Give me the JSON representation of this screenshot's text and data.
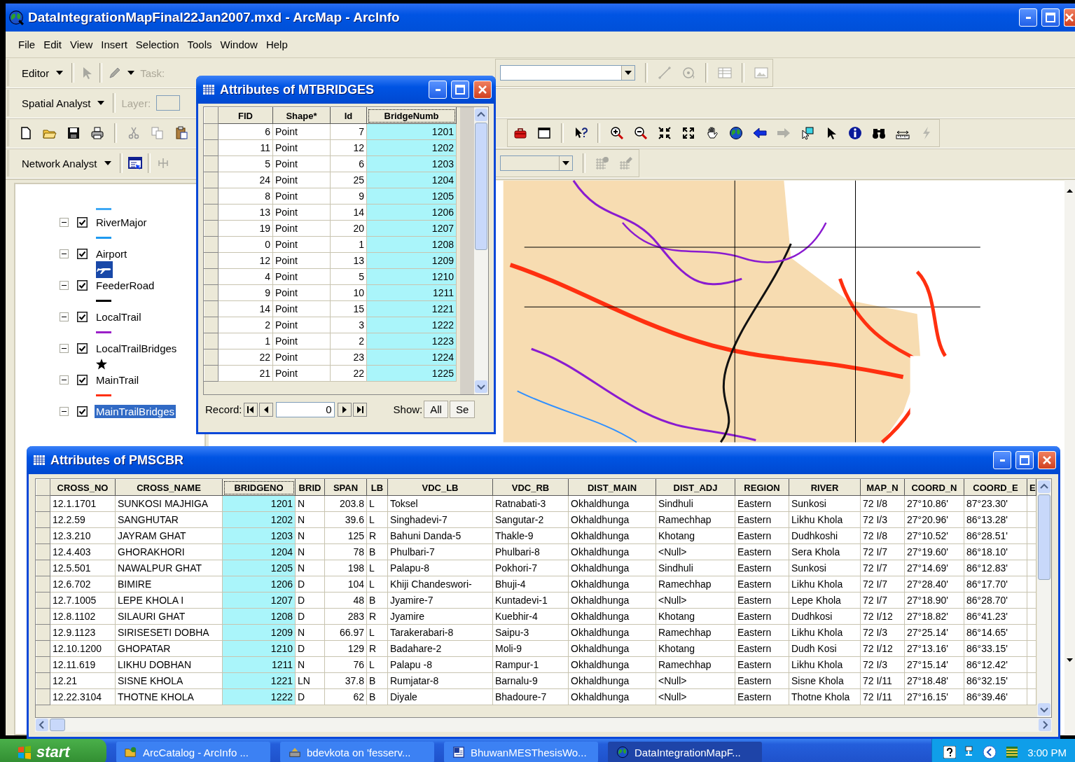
{
  "window": {
    "title": "DataIntegrationMapFinal22Jan2007.mxd - ArcMap - ArcInfo"
  },
  "menu": [
    "File",
    "Edit",
    "View",
    "Insert",
    "Selection",
    "Tools",
    "Window",
    "Help"
  ],
  "toolbars": {
    "editor": {
      "label": "Editor",
      "task_label": "Task:"
    },
    "spatial_analyst": {
      "label": "Spatial Analyst",
      "layer_label": "Layer:"
    },
    "network_analyst": {
      "label": "Network Analyst"
    }
  },
  "toc": {
    "leading_symbol": {
      "kind": "line",
      "color": "#3fa9f5"
    },
    "items": [
      {
        "label": "RiverMajor",
        "expanded": true,
        "checked": true,
        "selected": false,
        "symbol": {
          "kind": "line",
          "color": "#1e9af0"
        }
      },
      {
        "label": "Airport",
        "expanded": true,
        "checked": true,
        "selected": false,
        "symbol": {
          "kind": "airplane"
        }
      },
      {
        "label": "FeederRoad",
        "expanded": true,
        "checked": true,
        "selected": false,
        "symbol": {
          "kind": "line",
          "color": "#000000"
        }
      },
      {
        "label": "LocalTrail",
        "expanded": true,
        "checked": true,
        "selected": false,
        "symbol": {
          "kind": "line",
          "color": "#9b1fc8"
        }
      },
      {
        "label": "LocalTrailBridges",
        "expanded": true,
        "checked": true,
        "selected": false,
        "symbol": {
          "kind": "star"
        }
      },
      {
        "label": "MainTrail",
        "expanded": true,
        "checked": true,
        "selected": false,
        "symbol": {
          "kind": "line",
          "color": "#ff3010"
        }
      },
      {
        "label": "MainTrailBridges",
        "expanded": true,
        "checked": true,
        "selected": true
      }
    ]
  },
  "mtbridges": {
    "title": "Attributes of MTBRIDGES",
    "columns": [
      {
        "label": "FID",
        "kind": "number",
        "selected": false
      },
      {
        "label": "Shape*",
        "kind": "text",
        "selected": false
      },
      {
        "label": "Id",
        "kind": "number",
        "selected": false
      },
      {
        "label": "BridgeNumb",
        "kind": "number",
        "selected": true
      }
    ],
    "rows": [
      [
        "6",
        "Point",
        "7",
        "1201"
      ],
      [
        "11",
        "Point",
        "12",
        "1202"
      ],
      [
        "5",
        "Point",
        "6",
        "1203"
      ],
      [
        "24",
        "Point",
        "25",
        "1204"
      ],
      [
        "8",
        "Point",
        "9",
        "1205"
      ],
      [
        "13",
        "Point",
        "14",
        "1206"
      ],
      [
        "19",
        "Point",
        "20",
        "1207"
      ],
      [
        "0",
        "Point",
        "1",
        "1208"
      ],
      [
        "12",
        "Point",
        "13",
        "1209"
      ],
      [
        "4",
        "Point",
        "5",
        "1210"
      ],
      [
        "9",
        "Point",
        "10",
        "1211"
      ],
      [
        "14",
        "Point",
        "15",
        "1221"
      ],
      [
        "2",
        "Point",
        "3",
        "1222"
      ],
      [
        "1",
        "Point",
        "2",
        "1223"
      ],
      [
        "22",
        "Point",
        "23",
        "1224"
      ],
      [
        "21",
        "Point",
        "22",
        "1225"
      ]
    ],
    "record_label": "Record:",
    "record_value": "0",
    "show_label": "Show:",
    "show_all": "All",
    "show_selected": "Se"
  },
  "pmscbr": {
    "title": "Attributes of PMSCBR",
    "columns": [
      {
        "label": "CROSS_NO",
        "kind": "text",
        "selected": false
      },
      {
        "label": "CROSS_NAME",
        "kind": "text",
        "selected": false
      },
      {
        "label": "BRIDGENO",
        "kind": "number",
        "selected": true
      },
      {
        "label": "BRID",
        "kind": "text",
        "selected": false
      },
      {
        "label": "SPAN",
        "kind": "number",
        "selected": false
      },
      {
        "label": "LB",
        "kind": "text",
        "selected": false
      },
      {
        "label": "VDC_LB",
        "kind": "text",
        "selected": false
      },
      {
        "label": "VDC_RB",
        "kind": "text",
        "selected": false
      },
      {
        "label": "DIST_MAIN",
        "kind": "text",
        "selected": false
      },
      {
        "label": "DIST_ADJ",
        "kind": "text",
        "selected": false
      },
      {
        "label": "REGION",
        "kind": "text",
        "selected": false
      },
      {
        "label": "RIVER",
        "kind": "text",
        "selected": false
      },
      {
        "label": "MAP_N",
        "kind": "text",
        "selected": false
      },
      {
        "label": "COORD_N",
        "kind": "text",
        "selected": false
      },
      {
        "label": "COORD_E",
        "kind": "text",
        "selected": false
      },
      {
        "label": "E",
        "kind": "text",
        "selected": false
      }
    ],
    "rows": [
      [
        "12.1.1701",
        "SUNKOSI MAJHIGA",
        "1201",
        "N",
        "203.8",
        "L",
        "Toksel",
        "Ratnabati-3",
        "Okhaldhunga",
        "Sindhuli",
        "Eastern",
        "Sunkosi",
        "72 I/8",
        "27°10.86'",
        "87°23.30'"
      ],
      [
        "12.2.59",
        "SANGHUTAR",
        "1202",
        "N",
        "39.6",
        "L",
        "Singhadevi-7",
        "Sangutar-2",
        "Okhaldhunga",
        "Ramechhap",
        "Eastern",
        "Likhu Khola",
        "72 I/3",
        "27°20.96'",
        "86°13.28'"
      ],
      [
        "12.3.210",
        "JAYRAM GHAT",
        "1203",
        "N",
        "125",
        "R",
        "Bahuni Danda-5",
        "Thakle-9",
        "Okhaldhunga",
        "Khotang",
        "Eastern",
        "Dudhkoshi",
        "72 I/8",
        "27°10.52'",
        "86°28.51'"
      ],
      [
        "12.4.403",
        "GHORAKHORI",
        "1204",
        "N",
        "78",
        "B",
        "Phulbari-7",
        "Phulbari-8",
        "Okhaldhunga",
        "<Null>",
        "Eastern",
        "Sera Khola",
        "72 I/7",
        "27°19.60'",
        "86°18.10'"
      ],
      [
        "12.5.501",
        "NAWALPUR GHAT",
        "1205",
        "N",
        "198",
        "L",
        "Palapu-8",
        "Pokhori-7",
        "Okhaldhunga",
        "Sindhuli",
        "Eastern",
        "Sunkosi",
        "72 I/7",
        "27°14.69'",
        "86°12.83'"
      ],
      [
        "12.6.702",
        "BIMIRE",
        "1206",
        "D",
        "104",
        "L",
        "Khiji Chandeswori-",
        "Bhuji-4",
        "Okhaldhunga",
        "Ramechhap",
        "Eastern",
        "Likhu Khola",
        "72 I/7",
        "27°28.40'",
        "86°17.70'"
      ],
      [
        "12.7.1005",
        "LEPE KHOLA I",
        "1207",
        "D",
        "48",
        "B",
        "Jyamire-7",
        "Kuntadevi-1",
        "Okhaldhunga",
        "<Null>",
        "Eastern",
        "Lepe Khola",
        "72 I/7",
        "27°18.90'",
        "86°28.70'"
      ],
      [
        "12.8.1102",
        "SILAURI GHAT",
        "1208",
        "D",
        "283",
        "R",
        "Jyamire",
        "Kuebhir-4",
        "Okhaldhunga",
        "Khotang",
        "Eastern",
        "Dudhkosi",
        "72 I/12",
        "27°18.82'",
        "86°41.23'"
      ],
      [
        "12.9.1123",
        "SIRISESETI DOBHA",
        "1209",
        "N",
        "66.97",
        "L",
        "Tarakerabari-8",
        "Saipu-3",
        "Okhaldhunga",
        "Ramechhap",
        "Eastern",
        "Likhu Khola",
        "72 I/3",
        "27°25.14'",
        "86°14.65'"
      ],
      [
        "12.10.1200",
        "GHOPATAR",
        "1210",
        "D",
        "129",
        "R",
        "Badahare-2",
        "Moli-9",
        "Okhaldhunga",
        "Khotang",
        "Eastern",
        "Dudh Kosi",
        "72 I/12",
        "27°13.16'",
        "86°33.15'"
      ],
      [
        "12.11.619",
        "LIKHU DOBHAN",
        "1211",
        "N",
        "76",
        "L",
        "Palapu -8",
        "Rampur-1",
        "Okhaldhunga",
        "Ramechhap",
        "Eastern",
        "Likhu Khola",
        "72 I/3",
        "27°15.14'",
        "86°12.42'"
      ],
      [
        "12.21",
        "SISNE KHOLA",
        "1221",
        "LN",
        "37.8",
        "B",
        "Rumjatar-8",
        "Barnalu-9",
        "Okhaldhunga",
        "<Null>",
        "Eastern",
        "Sisne Khola",
        "72 I/11",
        "27°18.48'",
        "86°32.15'"
      ],
      [
        "12.22.3104",
        "THOTNE KHOLA",
        "1222",
        "D",
        "62",
        "B",
        "Diyale",
        "Bhadoure-7",
        "Okhaldhunga",
        "<Null>",
        "Eastern",
        "Thotne Khola",
        "72 I/11",
        "27°16.15'",
        "86°39.46'"
      ]
    ]
  },
  "taskbar": {
    "start": "start",
    "tasks": [
      {
        "label": "ArcCatalog - ArcInfo ...",
        "selected": false
      },
      {
        "label": "bdevkota on 'fesserv...",
        "selected": false
      },
      {
        "label": "BhuwanMESThesisWo...",
        "selected": false
      },
      {
        "label": "DataIntegrationMapF...",
        "selected": true
      }
    ],
    "clock": "3:00 PM"
  }
}
